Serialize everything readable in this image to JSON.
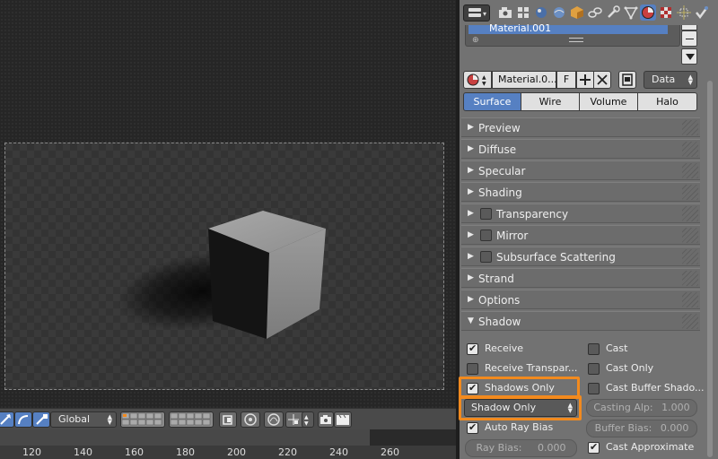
{
  "viewport": {
    "transform_orientation": "Global",
    "timeline_ticks": [
      "120",
      "140",
      "160",
      "180",
      "200",
      "220",
      "240",
      "260"
    ]
  },
  "properties": {
    "material_slots": [
      "Material.001"
    ],
    "material_selector": {
      "name": "Material.0...",
      "fake_user": "F",
      "link": "Data"
    },
    "type_tabs": [
      {
        "label": "Surface",
        "active": true
      },
      {
        "label": "Wire",
        "active": false
      },
      {
        "label": "Volume",
        "active": false
      },
      {
        "label": "Halo",
        "active": false
      }
    ],
    "panels": [
      {
        "label": "Preview",
        "expanded": false,
        "checkbox": false
      },
      {
        "label": "Diffuse",
        "expanded": false,
        "checkbox": false
      },
      {
        "label": "Specular",
        "expanded": false,
        "checkbox": false
      },
      {
        "label": "Shading",
        "expanded": false,
        "checkbox": false
      },
      {
        "label": "Transparency",
        "expanded": false,
        "checkbox": true
      },
      {
        "label": "Mirror",
        "expanded": false,
        "checkbox": true
      },
      {
        "label": "Subsurface Scattering",
        "expanded": false,
        "checkbox": true
      },
      {
        "label": "Strand",
        "expanded": false,
        "checkbox": false
      },
      {
        "label": "Options",
        "expanded": false,
        "checkbox": false
      },
      {
        "label": "Shadow",
        "expanded": true,
        "checkbox": false
      }
    ],
    "shadow": {
      "receive": {
        "label": "Receive",
        "checked": true
      },
      "receive_transparent": {
        "label": "Receive Transpar...",
        "checked": false
      },
      "shadows_only": {
        "label": "Shadows Only",
        "checked": true
      },
      "shadow_only_mode": "Shadow Only",
      "auto_ray_bias": {
        "label": "Auto Ray Bias",
        "checked": true
      },
      "ray_bias": "Ray Bias:",
      "ray_bias_value": "0.000",
      "cast": {
        "label": "Cast",
        "checked": false
      },
      "cast_only": {
        "label": "Cast Only",
        "checked": false
      },
      "cast_buffer_shadows": {
        "label": "Cast Buffer Shado...",
        "checked": false
      },
      "casting_alpha": "Casting Alp:",
      "casting_alpha_value": "1.000",
      "buffer_bias": "Buffer Bias:",
      "buffer_bias_value": "0.000",
      "cast_approximate": {
        "label": "Cast Approximate",
        "checked": true
      }
    }
  },
  "colors": {
    "accent": "#5680c2",
    "highlight": "#f28a1e",
    "panel_bg": "#727272"
  }
}
